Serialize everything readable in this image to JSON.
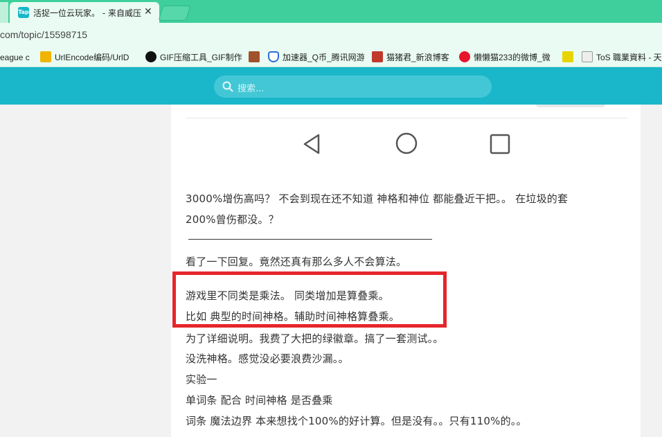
{
  "browser": {
    "tab": {
      "favicon_text": "Tap",
      "title": "活捉一位云玩家。 - 来自威压",
      "close_glyph": "✕"
    },
    "url": "com/topic/15598715",
    "bookmarks": [
      {
        "label": "eague c",
        "color": "#2a2a2a"
      },
      {
        "label": "UrlEncode编码/UrlD",
        "color": "#f0b400"
      },
      {
        "label": "GIF压缩工具_GIF制作",
        "color": "#111111"
      },
      {
        "label": "",
        "color": "#a0522d"
      },
      {
        "label": "加速器_Q币_腾讯网游",
        "color": "#2b6cd4"
      },
      {
        "label": "猫猪君_新浪博客",
        "color": "#c0392b"
      },
      {
        "label": "懒懒猫233的微博_微",
        "color": "#e6162d"
      },
      {
        "label": "",
        "color": "#e8d400"
      },
      {
        "label": "ToS 職業資料 - 天",
        "color": "#cccccc"
      }
    ]
  },
  "site": {
    "search_placeholder": "搜索..."
  },
  "post": {
    "lines": [
      "3000%增伤高吗？     不会到现在还不知道 神格和神位 都能叠近干把。。    在垃圾的套",
      "200%曾伤都没。？",
      "看了一下回复。竟然还真有那么多人不会算法。",
      "游戏里不同类是乘法。 同类增加是算叠乘。",
      "比如 典型的时间神格。辅助时间神格算叠乘。",
      "为了详细说明。我费了大把的绿徽章。搞了一套测试。。",
      "没洗神格。感觉没必要浪费沙漏。。",
      "实验一",
      "单词条 配合 时间神格 是否叠乘",
      "词条  魔法边界    本来想找个100%的好计算。但是没有。。只有110%的。。"
    ]
  },
  "colors": {
    "tab_strip": "#3fcf9d",
    "site_header": "#1ab6c9",
    "highlight": "#e5262b"
  }
}
